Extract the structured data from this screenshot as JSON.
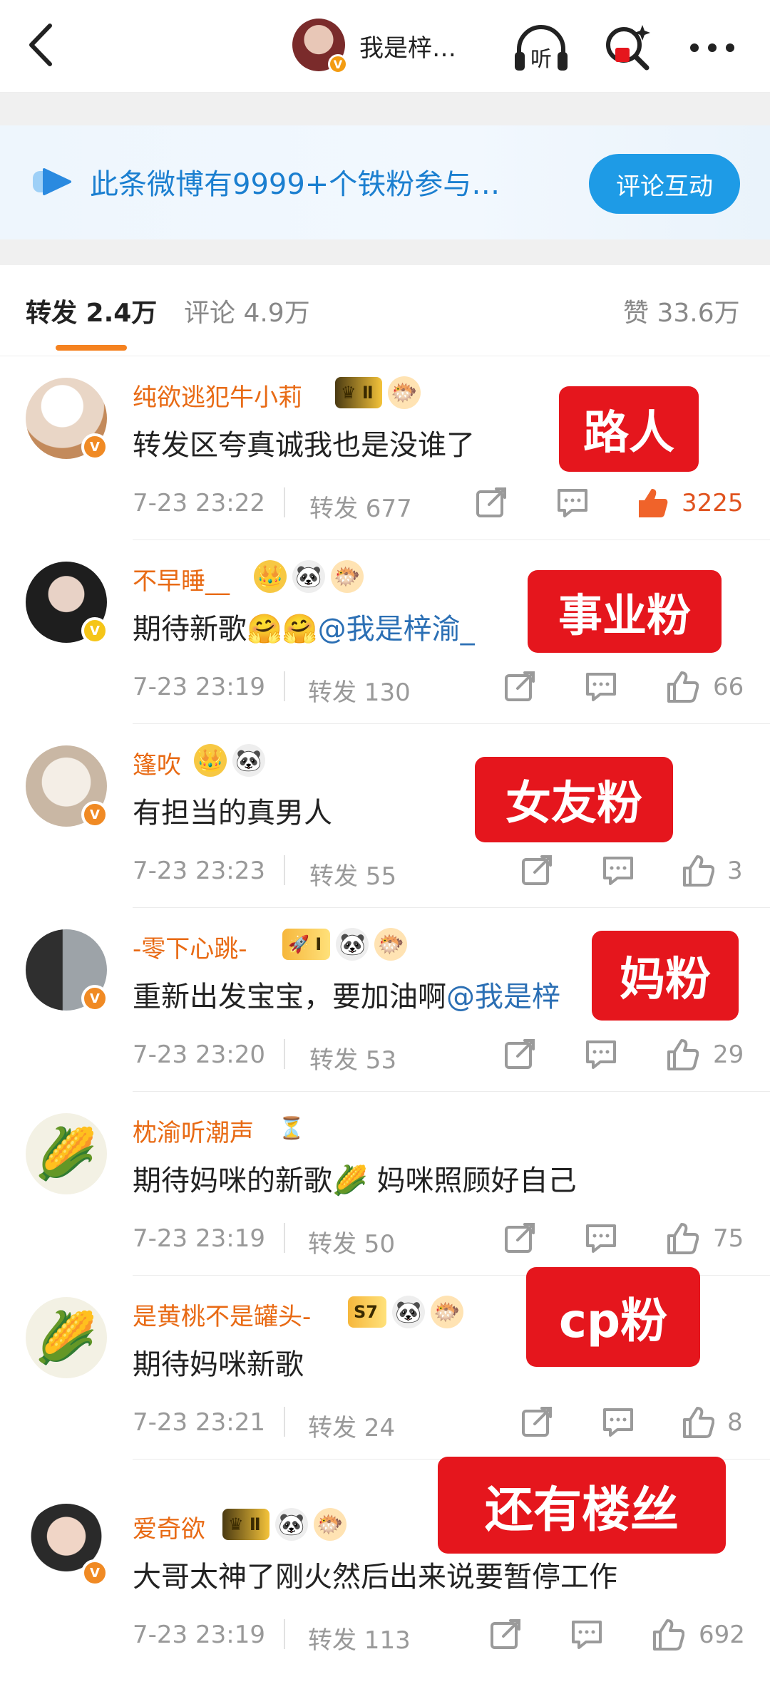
{
  "header": {
    "title": "我是梓…",
    "listen_label": "听",
    "back_icon": "chevron-left-icon",
    "more_icon": "more-dots-icon"
  },
  "banner": {
    "text": "此条微博有9999+个铁粉参与…",
    "button": "评论互动"
  },
  "tabs": {
    "repost": "转发 2.4万",
    "comment": "评论 4.9万",
    "like": "赞 33.6万"
  },
  "comments": [
    {
      "name": "纯欲逃犯牛小莉",
      "text": "转发区夸真诚我也是没谁了",
      "time": "7-23 23:22",
      "repost": "转发 677",
      "likes": "3225",
      "badge": "Ⅱ"
    },
    {
      "name": "不早睡__",
      "text": "期待新歌",
      "mention": "@我是梓渝_",
      "time": "7-23 23:19",
      "repost": "转发 130",
      "likes": "66"
    },
    {
      "name": "篷吹",
      "text": "有担当的真男人",
      "time": "7-23 23:23",
      "repost": "转发 55",
      "likes": "3"
    },
    {
      "name": "-零下心跳-",
      "text": "重新出发宝宝，要加油啊",
      "mention": "@我是梓",
      "time": "7-23 23:20",
      "repost": "转发 53",
      "likes": "29",
      "badge": "I"
    },
    {
      "name": "枕渝听潮声",
      "text": "期待妈咪的新歌",
      "text2": "妈咪照顾好自己",
      "time": "7-23 23:19",
      "repost": "转发 50",
      "likes": "75"
    },
    {
      "name": "是黄桃不是罐头-",
      "text": "期待妈咪新歌",
      "time": "7-23 23:21",
      "repost": "转发 24",
      "likes": "8",
      "badge": "S7"
    },
    {
      "name": "爱奇欲",
      "text": "大哥太神了刚火然后出来说要暂停工作",
      "time": "7-23 23:19",
      "repost": "转发 113",
      "likes": "692",
      "badge": "Ⅱ"
    }
  ],
  "tags": [
    "路人",
    "事业粉",
    "女友粉",
    "妈粉",
    "cp粉",
    "还有楼丝"
  ],
  "colors": {
    "accent": "#f58220",
    "username": "#e86a14",
    "tag": "#e5161d",
    "banner_btn": "#1e9be6"
  }
}
